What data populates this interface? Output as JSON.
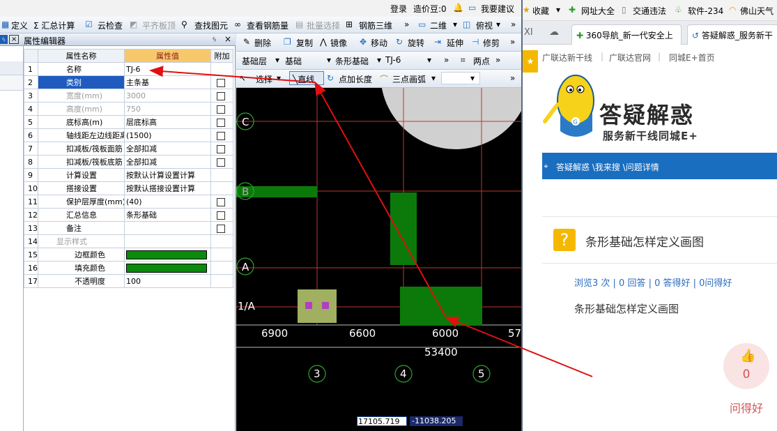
{
  "topbar": {
    "login": "登录",
    "price_beans": "造价豆:0",
    "suggest": "我要建议"
  },
  "toolbar1": {
    "define": "定义",
    "sum_calc": "Σ 汇总计算",
    "cloud_check": "云检查",
    "flat_top": "平齐板顶",
    "find_element": "查找图元",
    "view_rebar": "查看钢筋量",
    "batch_select": "批量选择",
    "rebar_3d": "钢筋三维",
    "view_mode": "二维",
    "view_angle": "俯视"
  },
  "panel": {
    "title": "属性编辑器"
  },
  "prop_table": {
    "headers": {
      "name": "属性名称",
      "value": "属性值",
      "extra": "附加"
    },
    "rows": [
      {
        "num": "1",
        "name": "名称",
        "value": "TJ-6",
        "check": false
      },
      {
        "num": "2",
        "name": "类别",
        "value": "主条基",
        "check": true
      },
      {
        "num": "3",
        "name": "宽度(mm)",
        "value": "3000",
        "check": true
      },
      {
        "num": "4",
        "name": "高度(mm)",
        "value": "750",
        "check": true
      },
      {
        "num": "5",
        "name": "底标高(m)",
        "value": "层底标高",
        "check": true
      },
      {
        "num": "6",
        "name": "轴线距左边线距离",
        "value": "(1500)",
        "check": true
      },
      {
        "num": "7",
        "name": "扣减板/筏板面筋",
        "value": "全部扣减",
        "check": true
      },
      {
        "num": "8",
        "name": "扣减板/筏板底筋",
        "value": "全部扣减",
        "check": true
      },
      {
        "num": "9",
        "name": "计算设置",
        "value": "按默认计算设置计算",
        "check": false
      },
      {
        "num": "10",
        "name": "搭接设置",
        "value": "按默认搭接设置计算",
        "check": false
      },
      {
        "num": "11",
        "name": "保护层厚度(mm)",
        "value": "(40)",
        "check": true
      },
      {
        "num": "12",
        "name": "汇总信息",
        "value": "条形基础",
        "check": true
      },
      {
        "num": "13",
        "name": "备注",
        "value": "",
        "check": true
      },
      {
        "num": "14",
        "name": "显示样式",
        "value": "",
        "check": false
      },
      {
        "num": "15",
        "name": "边框颜色",
        "value": "",
        "check": false
      },
      {
        "num": "16",
        "name": "填充颜色",
        "value": "",
        "check": false
      },
      {
        "num": "17",
        "name": "不透明度",
        "value": "100",
        "check": false
      }
    ]
  },
  "cad_toolbar1": {
    "delete": "删除",
    "copy": "复制",
    "mirror": "镜像",
    "move": "移动",
    "rotate": "旋转",
    "extend": "延伸",
    "trim": "修剪"
  },
  "cad_toolbar2": {
    "floor": "基础层",
    "category": "基础",
    "element_type": "条形基础",
    "element_name": "TJ-6",
    "two_point": "两点"
  },
  "cad_toolbar3": {
    "select": "选择",
    "line": "直线",
    "point_length": "点加长度",
    "three_point_arc": "三点画弧"
  },
  "cad": {
    "axis_rows": [
      "C",
      "B",
      "A",
      "1/A"
    ],
    "axis_cols": [
      "3",
      "4",
      "5"
    ],
    "dims": [
      "6900",
      "6600",
      "6000",
      "57"
    ],
    "total_dim": "53400",
    "coord_x": "17105.719",
    "coord_y": "-11038.205",
    "colors": {
      "strip": "#0b7a0b",
      "axis": "#c0392b"
    }
  },
  "browser": {
    "favorites": "收藏",
    "url_nav": "网址大全",
    "traffic": "交通违法",
    "software": "软件-234",
    "weather": "佛山天气",
    "tab1": "360导航_新一代安全上",
    "tab2": "答疑解惑_服务新干",
    "links": [
      "广联达新干线",
      "广联达官网",
      "同城E+首页"
    ]
  },
  "site": {
    "banner_title": "答疑解惑",
    "banner_sub": "服务新干线同城E+",
    "breadcrumb": "答疑解惑 \\我来搜 \\问题详情",
    "question_title": "条形基础怎样定义画图",
    "stats": "浏览3 次 | 0 回答 | 0 答得好 | 0问得好",
    "question_body": "条形基础怎样定义画图",
    "like_count": "0",
    "like_label": "问得好"
  }
}
